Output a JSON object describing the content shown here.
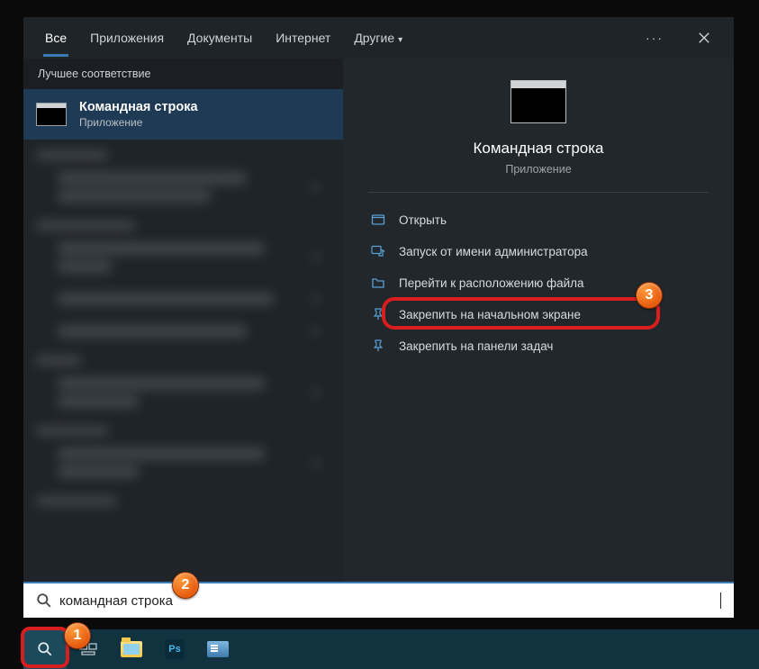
{
  "tabs": {
    "all": "Все",
    "apps": "Приложения",
    "docs": "Документы",
    "web": "Интернет",
    "more": "Другие"
  },
  "left": {
    "best_match_header": "Лучшее соответствие",
    "best_title": "Командная строка",
    "best_sub": "Приложение"
  },
  "right": {
    "title": "Командная строка",
    "sub": "Приложение",
    "actions": {
      "open": "Открыть",
      "run_admin": "Запуск от имени администратора",
      "open_location": "Перейти к расположению файла",
      "pin_start": "Закрепить на начальном экране",
      "pin_taskbar": "Закрепить на панели задач"
    }
  },
  "search": {
    "value": "командная строка"
  },
  "callouts": {
    "c1": "1",
    "c2": "2",
    "c3": "3"
  }
}
